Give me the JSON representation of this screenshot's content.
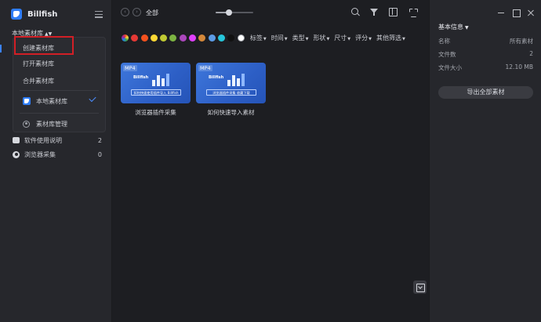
{
  "app": {
    "name": "Billfish"
  },
  "sidebar": {
    "library_switch": "本地素材库",
    "dropdown": {
      "create": "创建素材库",
      "open": "打开素材库",
      "merge": "合并素材库",
      "local": "本地素材库",
      "manage": "素材库管理"
    },
    "items": [
      {
        "label": "软件使用说明",
        "count": "2",
        "icon": "help-icon"
      },
      {
        "label": "浏览器采集",
        "count": "0",
        "icon": "browser-icon"
      }
    ]
  },
  "topbar": {
    "breadcrumb": "全部",
    "zoom_level": 0.35
  },
  "filters": {
    "colors": [
      "rainbow",
      "#e53935",
      "#f4511e",
      "#fdd835",
      "#c0ca33",
      "#7cb342",
      "#ab47bc",
      "#e040fb",
      "#d4883a",
      "#5c9ce6",
      "#26c6da",
      "#111111",
      "#ffffff"
    ],
    "labels": [
      "标签",
      "时间",
      "类型",
      "形状",
      "尺寸",
      "评分",
      "其他筛选"
    ]
  },
  "cards": [
    {
      "badge": "MP4",
      "brand": "Billfish",
      "banner": "如何快速使用插件导入 Billfish",
      "title": "浏览器插件采集"
    },
    {
      "badge": "MP4",
      "brand": "Billfish",
      "banner": "浏览器插件采集 收藏下载",
      "title": "如何快速导入素材"
    }
  ],
  "info_panel": {
    "title": "基本信息",
    "rows": [
      {
        "key": "名称",
        "value": "所有素材"
      },
      {
        "key": "文件数",
        "value": "2"
      },
      {
        "key": "文件大小",
        "value": "12.10 MB"
      }
    ],
    "export_button": "导出全部素材"
  }
}
